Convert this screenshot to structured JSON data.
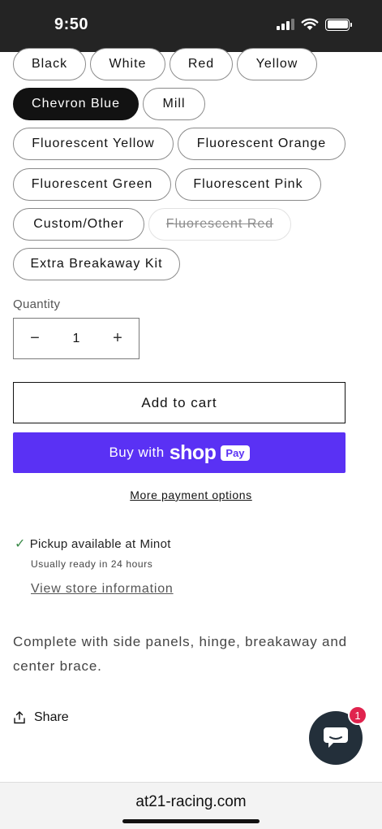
{
  "status_bar": {
    "time": "9:50"
  },
  "variants": {
    "options": [
      {
        "label": "Black",
        "state": "normal"
      },
      {
        "label": "White",
        "state": "normal"
      },
      {
        "label": "Red",
        "state": "normal"
      },
      {
        "label": "Yellow",
        "state": "normal"
      },
      {
        "label": "Chevron Blue",
        "state": "selected"
      },
      {
        "label": "Mill",
        "state": "normal"
      },
      {
        "label": "Fluorescent Yellow",
        "state": "normal"
      },
      {
        "label": "Fluorescent Orange",
        "state": "normal"
      },
      {
        "label": "Fluorescent Green",
        "state": "normal"
      },
      {
        "label": "Fluorescent Pink",
        "state": "normal"
      },
      {
        "label": "Custom/Other",
        "state": "normal"
      },
      {
        "label": "Fluorescent Red",
        "state": "unavailable"
      },
      {
        "label": "Extra Breakaway Kit",
        "state": "normal"
      }
    ]
  },
  "quantity": {
    "label": "Quantity",
    "value": "1",
    "minus": "−",
    "plus": "+"
  },
  "actions": {
    "add_to_cart": "Add to cart",
    "buy_with": "Buy with",
    "shop_word": "shop",
    "pay_badge": "Pay",
    "more_payment": "More payment options"
  },
  "pickup": {
    "prefix": "Pickup available at",
    "location": "Minot",
    "ready": "Usually ready in 24 hours",
    "view_store": "View store information"
  },
  "description": "Complete with side panels, hinge, breakaway and center brace.",
  "share": {
    "label": "Share"
  },
  "chat": {
    "badge_count": "1"
  },
  "browser": {
    "url": "at21-racing.com"
  },
  "colors": {
    "shop_pay": "#5a31f4",
    "selected": "#121212",
    "chat": "#232f3a",
    "badge": "#e0234e",
    "check": "#3a8a48"
  }
}
